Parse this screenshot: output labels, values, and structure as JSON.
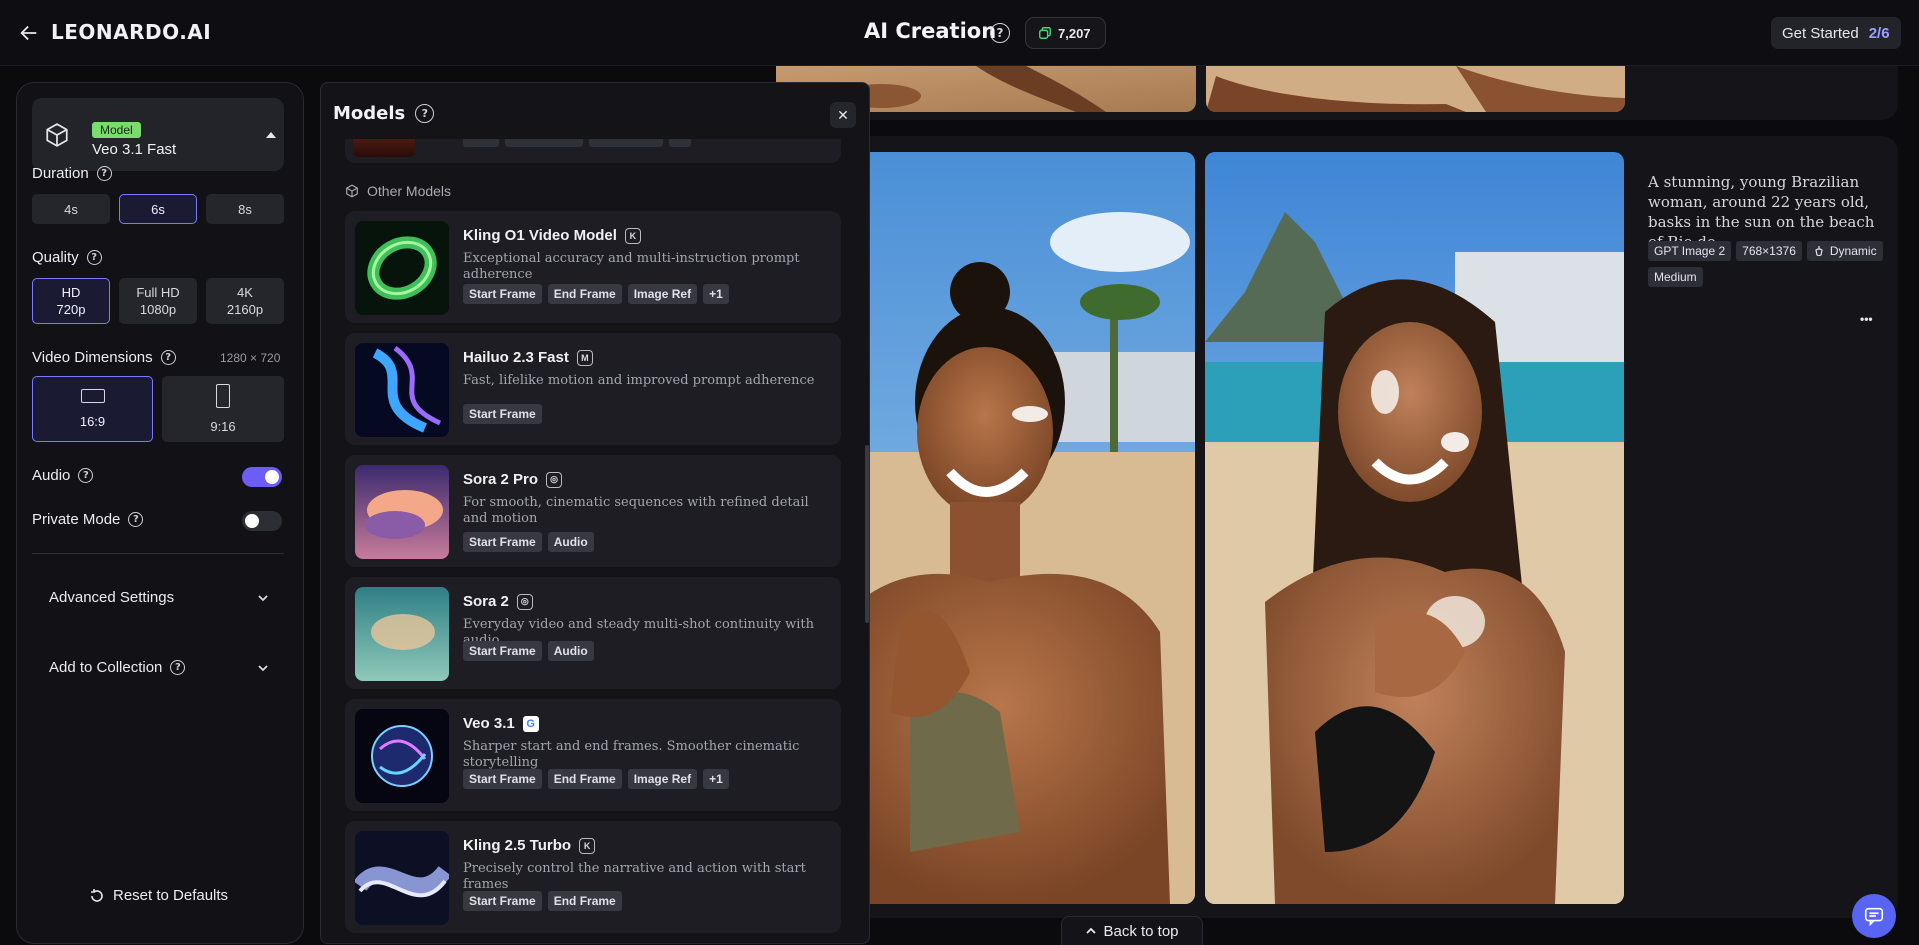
{
  "topbar": {
    "brand": "LEONARDO.AI",
    "title": "AI Creation",
    "help_glyph": "?",
    "tokens": "7,207",
    "get_started": "Get Started",
    "step": "2/6"
  },
  "left_panel": {
    "model_badge": "Model",
    "model_name": "Veo 3.1 Fast",
    "duration_label": "Duration",
    "durations": [
      "4s",
      "6s",
      "8s"
    ],
    "quality_label": "Quality",
    "qualities": [
      {
        "name": "HD",
        "res": "720p"
      },
      {
        "name": "Full HD",
        "res": "1080p"
      },
      {
        "name": "4K",
        "res": "2160p"
      }
    ],
    "dimensions_label": "Video Dimensions",
    "dimensions_value": "1280 × 720",
    "ratios": [
      "16:9",
      "9:16"
    ],
    "audio_label": "Audio",
    "audio_on": true,
    "private_label": "Private Mode",
    "private_on": false,
    "advanced_label": "Advanced Settings",
    "collection_label": "Add to Collection",
    "reset_label": "Reset to Defaults"
  },
  "models_panel": {
    "title": "Models",
    "close_glyph": "✕",
    "section_label": "Other Models",
    "items": [
      {
        "name": "Kling O1 Video Model",
        "provider_icon": "kling-icon",
        "desc": "Exceptional accuracy and multi-instruction prompt adherence",
        "tags": [
          "Start Frame",
          "End Frame",
          "Image Ref",
          "+1"
        ]
      },
      {
        "name": "Hailuo 2.3 Fast",
        "provider_icon": "minimax-icon",
        "desc": "Fast, lifelike motion and improved prompt adherence",
        "tags": [
          "Start Frame"
        ]
      },
      {
        "name": "Sora 2 Pro",
        "provider_icon": "openai-icon",
        "desc": "For smooth, cinematic sequences with refined detail and motion",
        "tags": [
          "Start Frame",
          "Audio"
        ]
      },
      {
        "name": "Sora 2",
        "provider_icon": "openai-icon",
        "desc": "Everyday video and steady multi-shot continuity with audio",
        "tags": [
          "Start Frame",
          "Audio"
        ]
      },
      {
        "name": "Veo 3.1",
        "provider_icon": "google-icon",
        "desc": "Sharper start and end frames. Smoother cinematic storytelling",
        "tags": [
          "Start Frame",
          "End Frame",
          "Image Ref",
          "+1"
        ]
      },
      {
        "name": "Kling 2.5 Turbo",
        "provider_icon": "kling-icon",
        "desc": "Precisely control the narrative and action with start frames",
        "tags": [
          "Start Frame",
          "End Frame"
        ]
      }
    ]
  },
  "gallery": {
    "prompt": "A stunning, young Brazilian woman, around 22 years old, basks in the sun on the beach of Rio de...",
    "meta": [
      "GPT Image 2",
      "768×1376",
      "Dynamic",
      "Medium"
    ],
    "more_glyph": "•••",
    "back_to_top": "Back to top"
  },
  "colors": {
    "accent": "#7b7bff",
    "toggle_on": "#6b5df5",
    "model_badge": "#7bdc6e",
    "chat_button": "#5865f2"
  }
}
